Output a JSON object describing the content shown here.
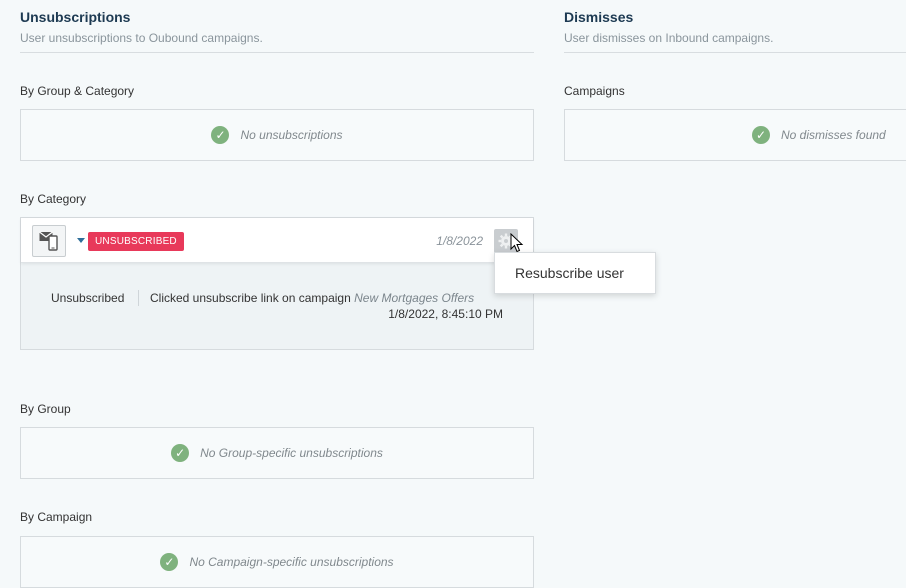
{
  "unsubscriptions": {
    "title": "Unsubscriptions",
    "subtitle": "User unsubscriptions to Oubound campaigns.",
    "by_group_category": {
      "label": "By Group & Category",
      "empty": "No unsubscriptions"
    },
    "by_category": {
      "label": "By Category",
      "item": {
        "status_badge": "UNSUBSCRIBED",
        "date": "1/8/2022",
        "detail_status": "Unsubscribed",
        "detail_text": "Clicked unsubscribe link on campaign",
        "detail_campaign": "New Mortgages Offers",
        "detail_time": "1/8/2022, 8:45:10 PM"
      }
    },
    "by_group": {
      "label": "By Group",
      "empty": "No Group-specific unsubscriptions"
    },
    "by_campaign": {
      "label": "By Campaign",
      "empty": "No Campaign-specific unsubscriptions"
    }
  },
  "dismisses": {
    "title": "Dismisses",
    "subtitle": "User dismisses on Inbound campaigns.",
    "campaigns": {
      "label": "Campaigns",
      "empty": "No dismisses found"
    }
  },
  "context_menu": {
    "resubscribe": "Resubscribe user"
  },
  "icons": {
    "check": "check-circle-icon",
    "channel": "email-mobile-icon",
    "gear": "gear-icon",
    "caret": "caret-down-icon"
  },
  "colors": {
    "badge": "#e8395a",
    "check": "#7fb27e",
    "title": "#1d3a52"
  }
}
